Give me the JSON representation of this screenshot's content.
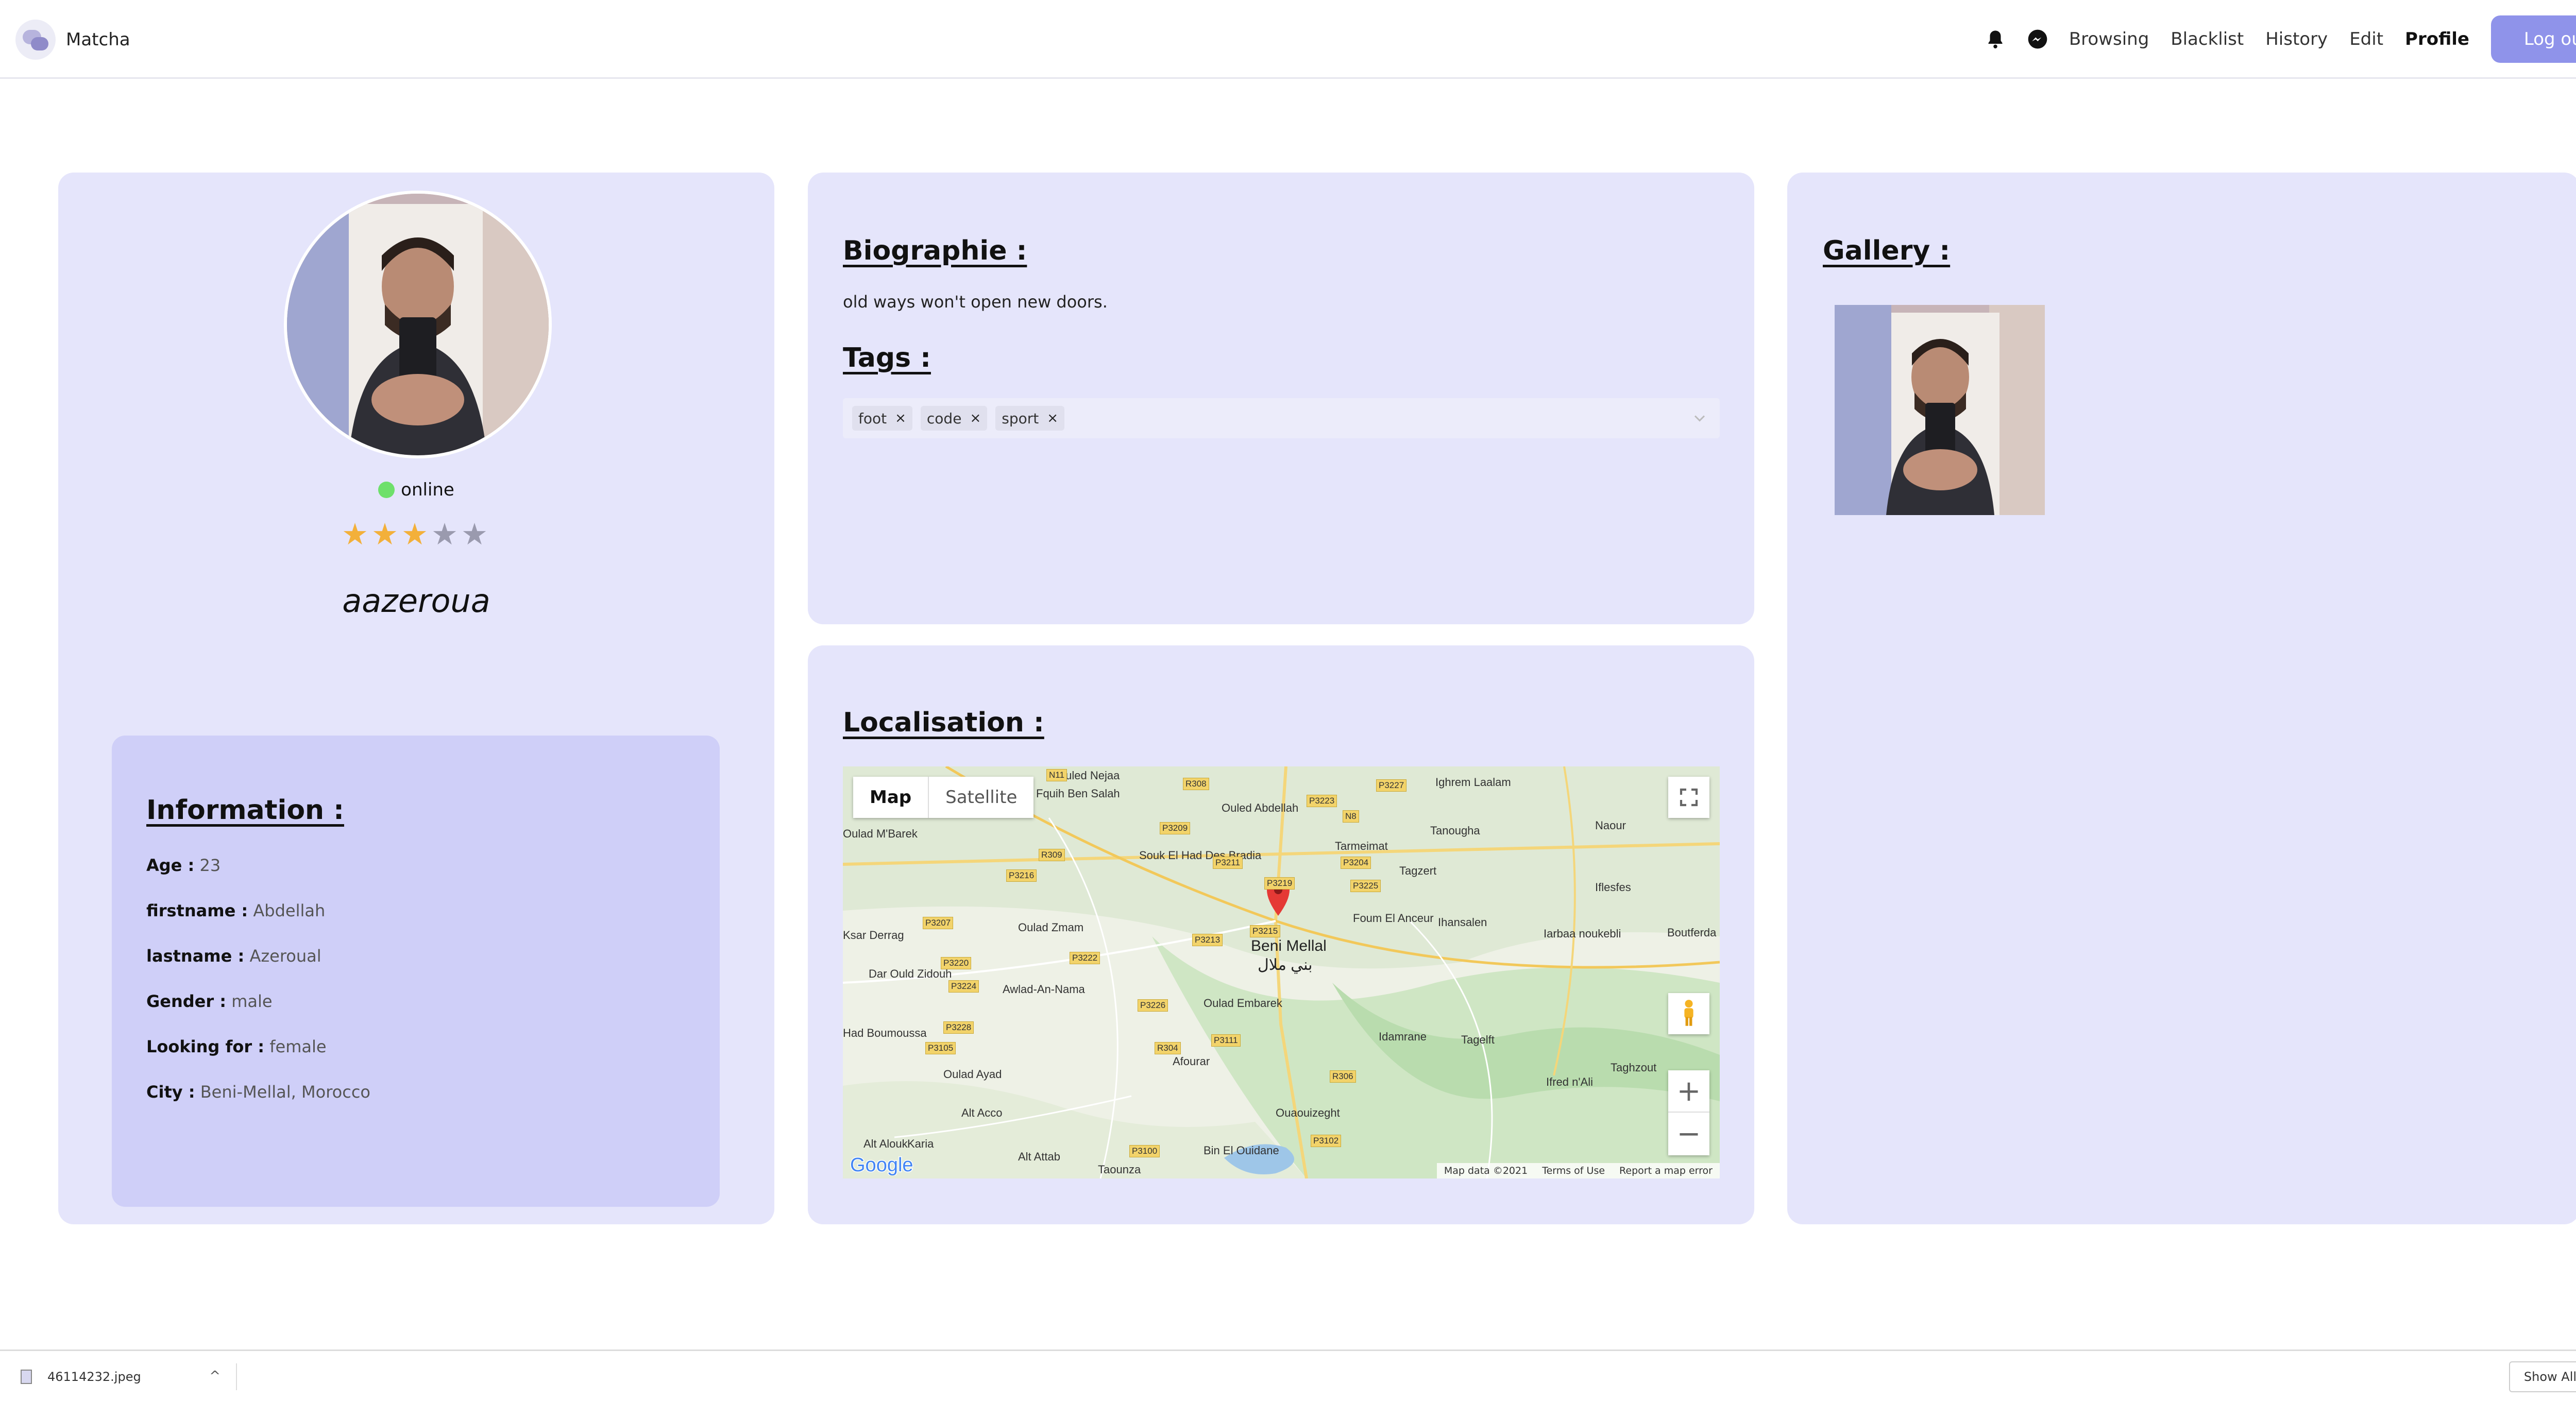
{
  "nav": {
    "brand": "Matcha",
    "links": {
      "browsing": "Browsing",
      "blacklist": "Blacklist",
      "history": "History",
      "edit": "Edit",
      "profile": "Profile"
    },
    "logout": "Log out",
    "icons": [
      "bell-icon",
      "messenger-icon"
    ],
    "accent_color": "#8f93ea"
  },
  "profile": {
    "status": "online",
    "status_color": "#6ee06b",
    "rating": 3,
    "rating_max": 5,
    "stars": [
      "★",
      "★",
      "★",
      "★",
      "★"
    ],
    "username": "aazeroua"
  },
  "information": {
    "title": "Information :",
    "age_label": "Age :",
    "age": "23",
    "firstname_label": "firstname :",
    "firstname": "Abdellah",
    "lastname_label": "lastname :",
    "lastname": "Azeroual",
    "gender_label": "Gender :",
    "gender": "male",
    "looking_label": "Looking for :",
    "looking": "female",
    "city_label": "City :",
    "city": "Beni-Mellal, Morocco"
  },
  "bio": {
    "title": "Biographie :",
    "text": "old ways won't open new doors.",
    "tags_title": "Tags :",
    "tags": [
      "foot",
      "code",
      "sport"
    ],
    "tag_remove": "×"
  },
  "localisation": {
    "title": "Localisation :",
    "map_type": {
      "map": "Map",
      "satellite": "Satellite"
    },
    "city_label": "Beni Mellal",
    "city_label_ar": "بني ملال",
    "zoom_in": "+",
    "zoom_out": "−",
    "logo": "Google",
    "footer": {
      "data": "Map data ©2021",
      "terms": "Terms of Use",
      "report": "Report a map error"
    },
    "places": [
      "Fquih Ben Salah",
      "Ouled Nejaa",
      "Ouled Abdellah",
      "Ighrem Laalam",
      "Tanougha",
      "Naour",
      "Tagzert",
      "Tarmeimat",
      "Iflesfes",
      "Souk El Had Des Bradia",
      "Oulad Zmam",
      "Oulad M'Barek",
      "Ksar Derrag",
      "Dar Ould Zidouh",
      "Awlad-An-Nama",
      "Oulad Embarek",
      "Foum El Anceur",
      "Ihansalen",
      "Iarbaa noukebli",
      "Boutferda",
      "Had Boumoussa",
      "Oulad Ayad",
      "Afourar",
      "Idamrane",
      "Tagelft",
      "Taghzout",
      "Ifred n'Ali",
      "Alt Acco",
      "Ouaouizeght",
      "Bin El Ouidane",
      "Alt Attab",
      "Taounza",
      "Alt Alouk",
      "Karia"
    ],
    "roads": [
      "N11",
      "R308",
      "P3223",
      "P3227",
      "N8",
      "P3209",
      "R309",
      "P3216",
      "P3211",
      "P3204",
      "P3219",
      "P3225",
      "P3207",
      "P3213",
      "P3215",
      "P3220",
      "P3222",
      "P3224",
      "P3228",
      "P3226",
      "P3105",
      "R304",
      "P3111",
      "R306",
      "P3100",
      "P3102"
    ]
  },
  "gallery": {
    "title": "Gallery :"
  },
  "downloads": {
    "file": "46114232.jpeg",
    "show_all": "Show All",
    "close": "×",
    "chevron": "^"
  }
}
